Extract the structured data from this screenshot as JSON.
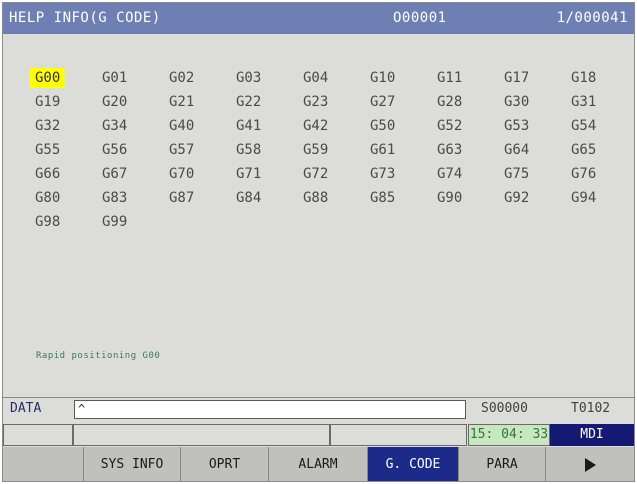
{
  "header": {
    "title": "HELP INFO(G CODE)",
    "program": "O00001",
    "page": "1/000041"
  },
  "gcodes": [
    "G00",
    "G01",
    "G02",
    "G03",
    "G04",
    "G10",
    "G11",
    "G17",
    "G18",
    "G19",
    "G20",
    "G21",
    "G22",
    "G23",
    "G27",
    "G28",
    "G30",
    "G31",
    "G32",
    "G34",
    "G40",
    "G41",
    "G42",
    "G50",
    "G52",
    "G53",
    "G54",
    "G55",
    "G56",
    "G57",
    "G58",
    "G59",
    "G61",
    "G63",
    "G64",
    "G65",
    "G66",
    "G67",
    "G70",
    "G71",
    "G72",
    "G73",
    "G74",
    "G75",
    "G76",
    "G80",
    "G83",
    "G87",
    "G84",
    "G88",
    "G85",
    "G90",
    "G92",
    "G94",
    "G98",
    "G99"
  ],
  "selected_index": 0,
  "description": "Rapid positioning G00",
  "status": {
    "data_label": "DATA",
    "data_value": "^",
    "spindle": "S00000",
    "tool": "T0102",
    "clock": "15: 04: 33",
    "mode": "MDI"
  },
  "softkeys": [
    {
      "label": "",
      "active": false
    },
    {
      "label": "SYS INFO",
      "active": false
    },
    {
      "label": "OPRT",
      "active": false
    },
    {
      "label": "ALARM",
      "active": false
    },
    {
      "label": "G. CODE",
      "active": true
    },
    {
      "label": "PARA",
      "active": false
    }
  ],
  "softkey_next_icon": "right-triangle-icon",
  "colors": {
    "title_bar": "#6e7fb4",
    "selected_highlight": "#ffff00",
    "active_softkey": "#1c2a8a",
    "mode_bg": "#141a74",
    "clock_bg": "#c8e6c0"
  }
}
